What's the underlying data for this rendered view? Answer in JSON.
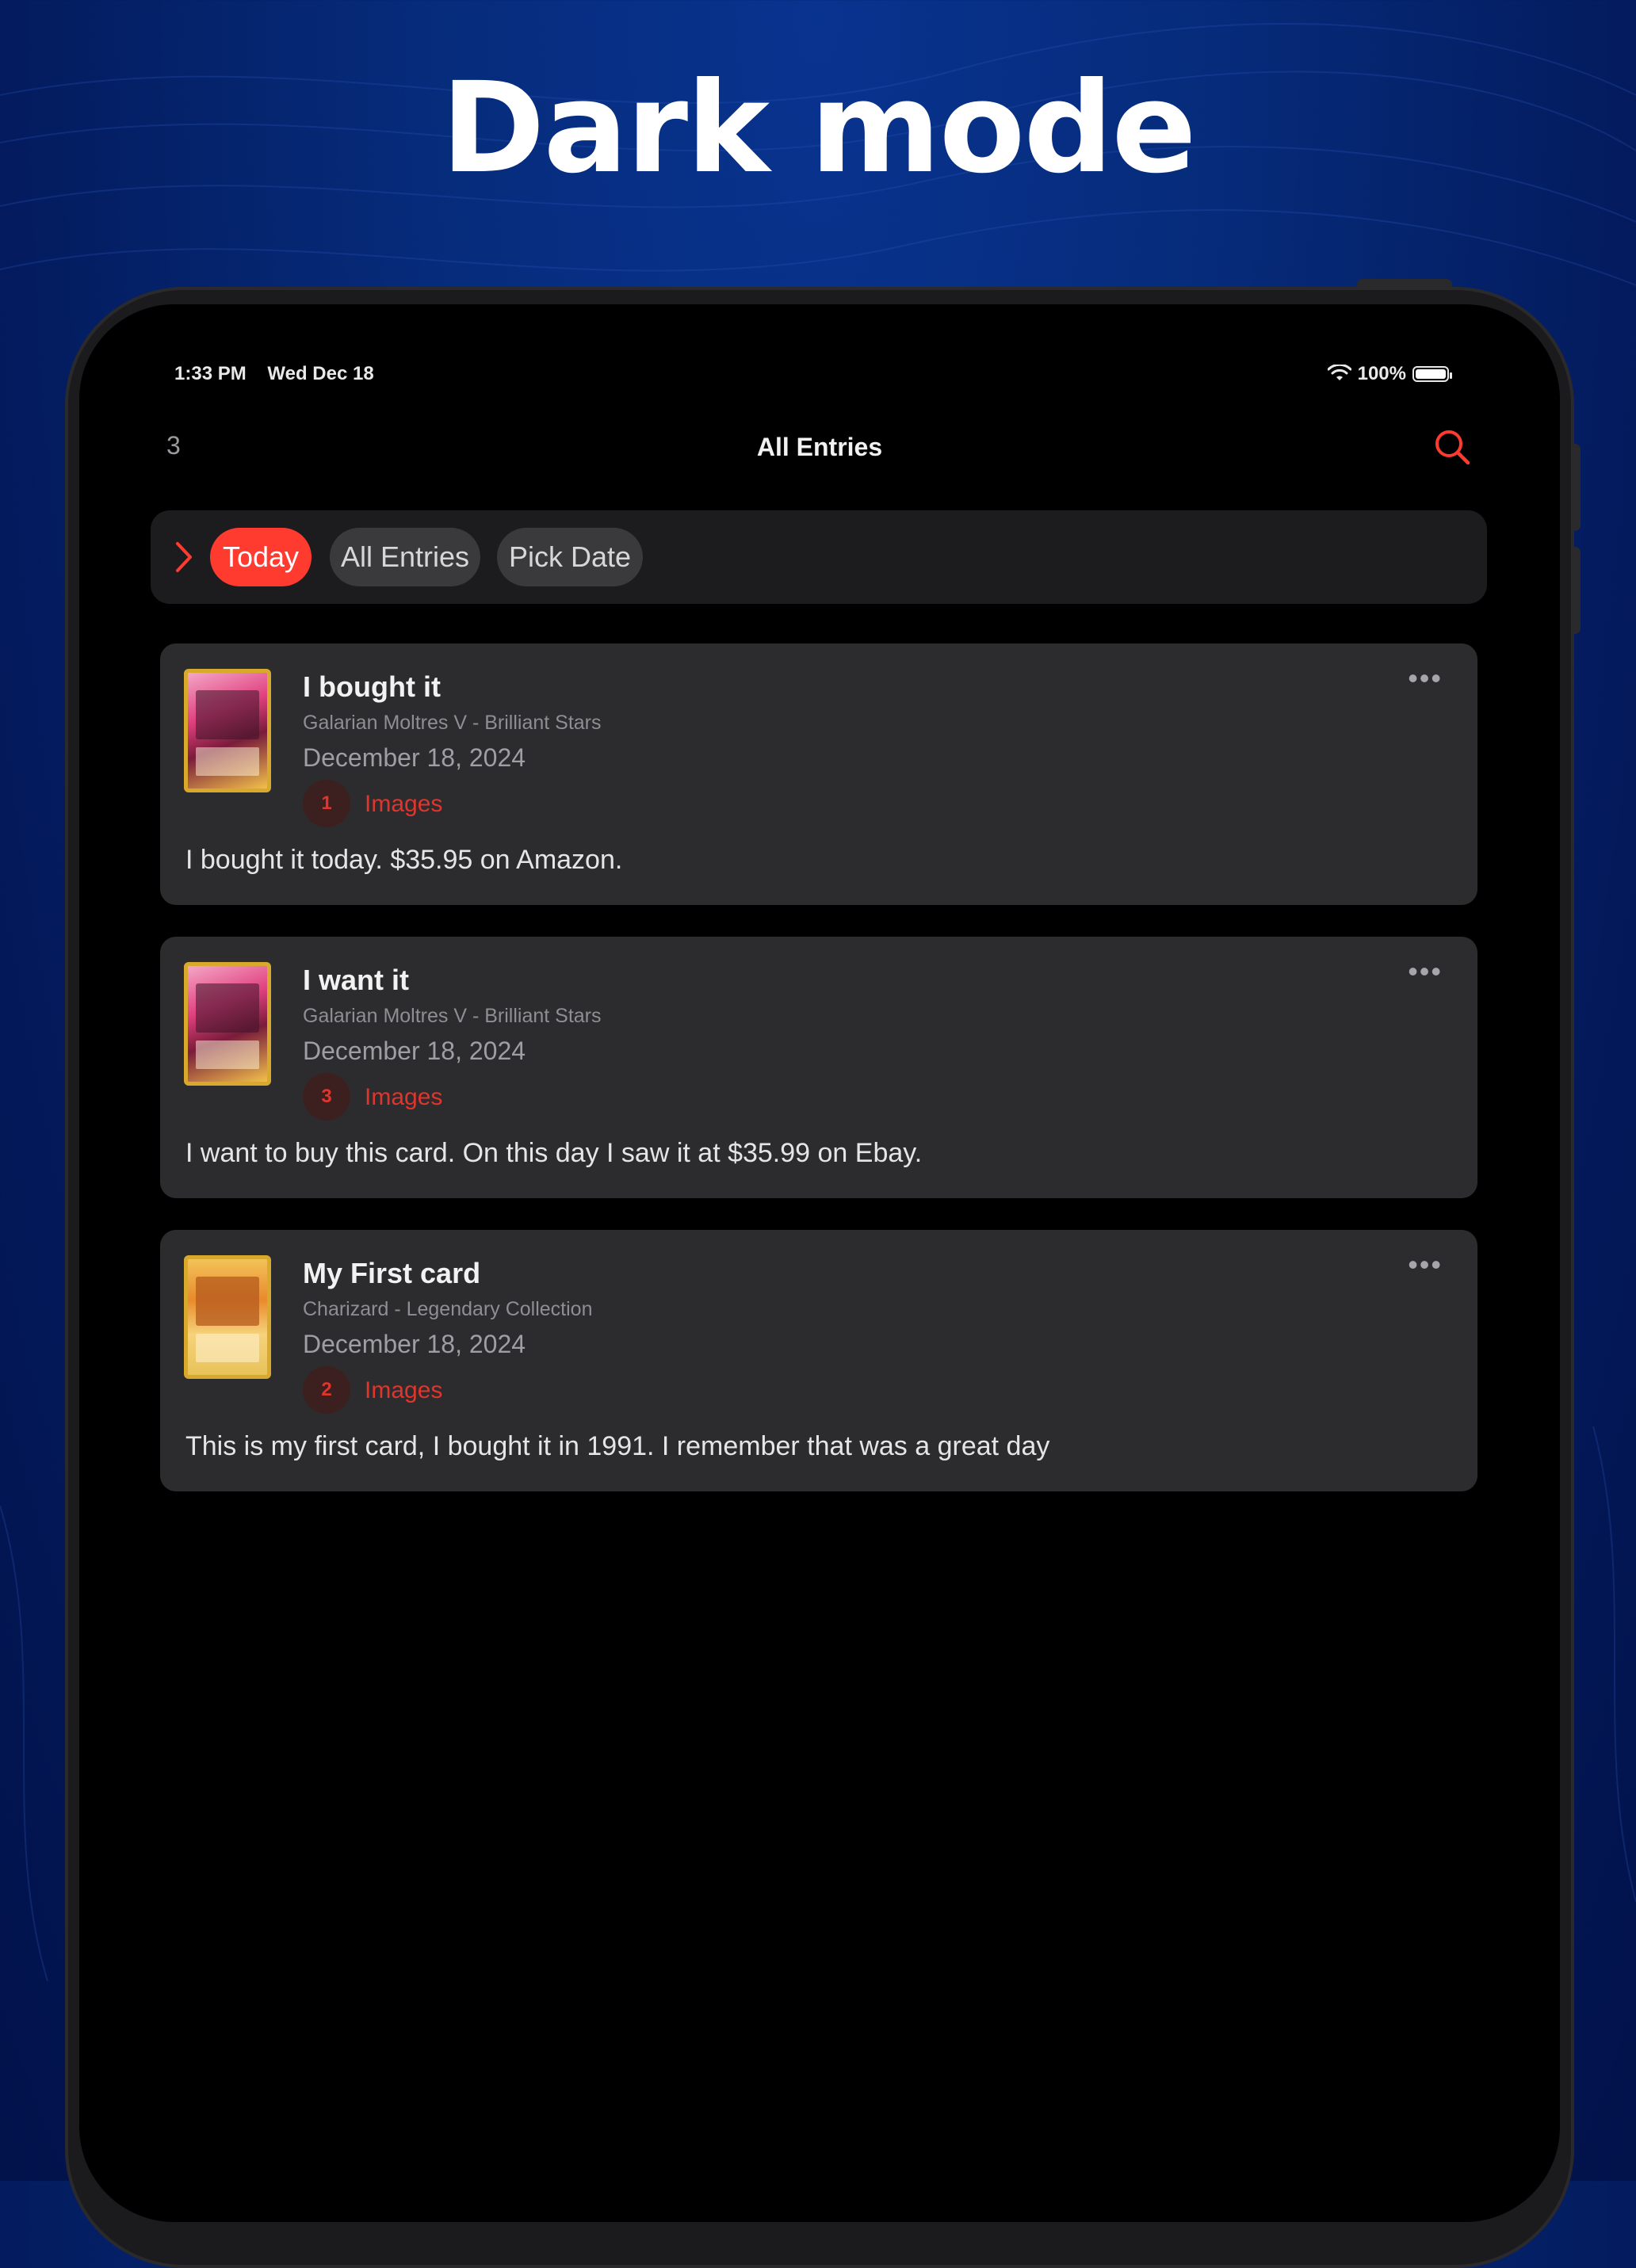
{
  "headline": "Dark mode",
  "status_bar": {
    "time": "1:33 PM",
    "date": "Wed Dec 18",
    "battery": "100%",
    "battery_level": 1.0
  },
  "nav": {
    "count": "3",
    "title": "All Entries",
    "search_icon": "search-icon"
  },
  "filters": {
    "today": "Today",
    "all_entries": "All Entries",
    "pick_date": "Pick Date"
  },
  "entries": [
    {
      "title": "I bought it",
      "subtitle": "Galarian Moltres V - Brilliant Stars",
      "date": "December 18, 2024",
      "image_count": "1",
      "images_label": "Images",
      "body": "I bought it today. $35.95 on Amazon.",
      "more": "•••"
    },
    {
      "title": "I want it",
      "subtitle": "Galarian Moltres V - Brilliant Stars",
      "date": "December 18, 2024",
      "image_count": "3",
      "images_label": "Images",
      "body": "I want to buy this card. On this day I saw it at $35.99 on Ebay.",
      "more": "•••"
    },
    {
      "title": "My First card",
      "subtitle": "Charizard - Legendary Collection",
      "date": "December 18, 2024",
      "image_count": "2",
      "images_label": "Images",
      "body": "This is my first card, I bought it in 1991. I remember that was a great day",
      "more": "•••"
    }
  ],
  "colors": {
    "accent": "#ff3b30",
    "card_bg": "#2c2c2e",
    "screen_bg": "#000000"
  }
}
